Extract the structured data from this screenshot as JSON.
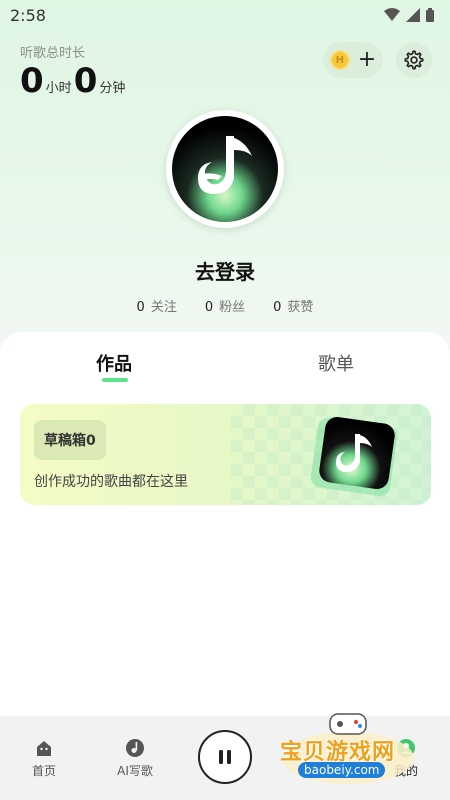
{
  "status_bar": {
    "time": "2:58"
  },
  "header": {
    "listen_label": "听歌总时长",
    "hours_value": "0",
    "hours_unit": "小时",
    "minutes_value": "0",
    "minutes_unit": "分钟"
  },
  "actions": {
    "coin_glyph": "H",
    "add_label": "+"
  },
  "profile": {
    "login_label": "去登录",
    "stats": [
      {
        "value": "0",
        "label": "关注"
      },
      {
        "value": "0",
        "label": "粉丝"
      },
      {
        "value": "0",
        "label": "获赞"
      }
    ]
  },
  "tabs": [
    {
      "label": "作品",
      "active": true
    },
    {
      "label": "歌单",
      "active": false
    }
  ],
  "drafts": {
    "badge": "草稿箱0",
    "description": "创作成功的歌曲都在这里"
  },
  "bottom_nav": {
    "home_label": "首页",
    "ai_label": "AI写歌",
    "mine_label": "我的"
  },
  "watermark": {
    "text": "宝贝游戏网",
    "url": "baobeiy.com"
  },
  "colors": {
    "accent_green": "#5fe08a",
    "coin_gold": "#f4c93a",
    "watermark_orange": "#f0a019"
  }
}
